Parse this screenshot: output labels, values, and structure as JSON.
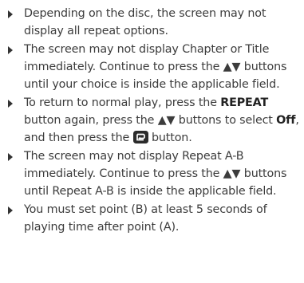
{
  "notes": [
    {
      "text": "Depending on the disc, the screen may not display all repeat options."
    },
    {
      "text": "The screen may not display Chapter or Title immediately. Continue to press the ▲▼ buttons until your choice is inside the applicable field."
    },
    {
      "part1": "To return to normal play, press the ",
      "repeat": "REPEAT",
      "part2": " button again, press the ▲▼ buttons to select ",
      "off": "Off",
      "part3": ", and then press the ",
      "icon": "enter-button-icon",
      "part4": " button."
    },
    {
      "text": "The screen may not display Repeat A-B immediately. Continue to press the ▲▼ buttons until Repeat A-B is inside the applicable field."
    },
    {
      "text": "You must set point (B) at least 5 seconds of playing time after point (A)."
    }
  ]
}
